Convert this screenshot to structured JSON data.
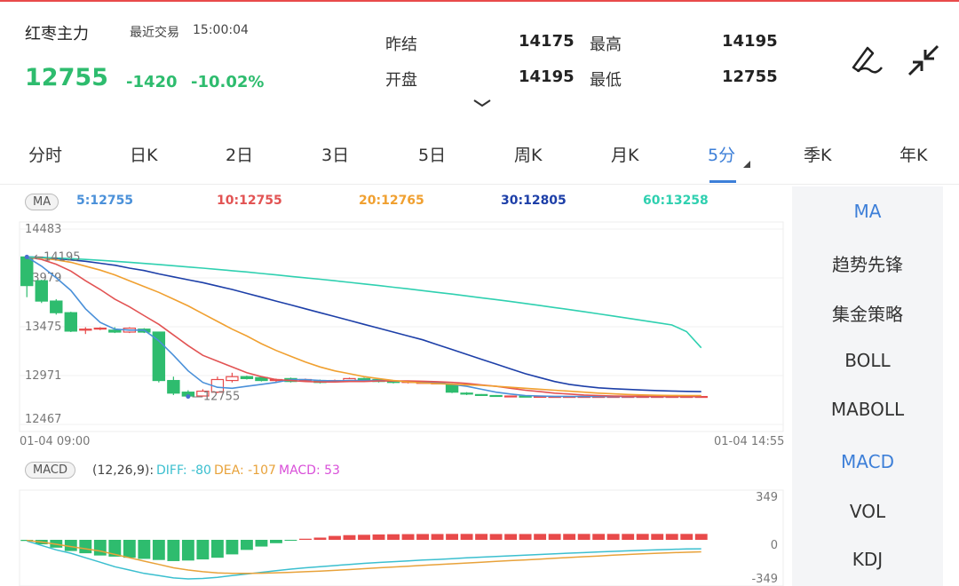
{
  "quote": {
    "name": "红枣主力",
    "trade_label": "最近交易",
    "trade_time": "15:00:04",
    "price": "12755",
    "change": "-1420",
    "change_pct": "-10.02%",
    "prev_settle_label": "昨结",
    "prev_settle": "14175",
    "open_label": "开盘",
    "open": "14195",
    "high_label": "最高",
    "high": "14195",
    "low_label": "最低",
    "low": "12755"
  },
  "tabs": [
    "分时",
    "日K",
    "2日",
    "3日",
    "5日",
    "周K",
    "月K",
    "5分",
    "季K",
    "年K"
  ],
  "active_tab": "5分",
  "ma_bar": {
    "pill": "MA",
    "ma5": "5:12755",
    "ma10": "10:12755",
    "ma20": "20:12765",
    "ma30": "30:12805",
    "ma60": "60:13258"
  },
  "main_indicators": [
    "MA",
    "趋势先锋",
    "集金策略",
    "BOLL",
    "MABOLL"
  ],
  "sub_indicators": [
    "MACD",
    "VOL",
    "KDJ"
  ],
  "macd_bar": {
    "pill": "MACD",
    "params": "(12,26,9):",
    "diff": "DIFF: -80",
    "dea": "DEA: -107",
    "macd": "MACD: 53"
  },
  "axis": {
    "price_ticks": [
      "14483",
      "13979",
      "13475",
      "12971",
      "12467"
    ],
    "max_marker": "14195",
    "min_marker": "12755",
    "time_start": "01-04 09:00",
    "time_end": "01-04 14:55",
    "macd_ticks": [
      "349",
      "0",
      "-349"
    ]
  },
  "colors": {
    "up": "#e84a4a",
    "down": "#2ebc6e",
    "ma5": "#4a90d9",
    "ma10": "#e25353",
    "ma20": "#f0a030",
    "ma30": "#1d3fa8",
    "ma60": "#2fd0b0",
    "diff": "#3bbfcf",
    "dea": "#e8a23a",
    "macd": "#d94fd9",
    "accent": "#3d7fd8"
  },
  "chart_data": [
    {
      "type": "candlestick",
      "x_range": [
        "01-04 09:00",
        "01-04 14:55"
      ],
      "ylim": [
        12467,
        14483
      ],
      "candles": [
        {
          "o": 14195,
          "c": 13900,
          "h": 14195,
          "l": 13780
        },
        {
          "o": 13950,
          "c": 13740,
          "h": 13960,
          "l": 13720
        },
        {
          "o": 13740,
          "c": 13620,
          "h": 13760,
          "l": 13600
        },
        {
          "o": 13620,
          "c": 13430,
          "h": 13630,
          "l": 13420
        },
        {
          "o": 13440,
          "c": 13450,
          "h": 13470,
          "l": 13400
        },
        {
          "o": 13460,
          "c": 13460,
          "h": 13470,
          "l": 13440
        },
        {
          "o": 13440,
          "c": 13420,
          "h": 13470,
          "l": 13410
        },
        {
          "o": 13420,
          "c": 13460,
          "h": 13470,
          "l": 13410
        },
        {
          "o": 13450,
          "c": 13420,
          "h": 13460,
          "l": 13410
        },
        {
          "o": 13420,
          "c": 12920,
          "h": 13420,
          "l": 12900
        },
        {
          "o": 12920,
          "c": 12790,
          "h": 12960,
          "l": 12770
        },
        {
          "o": 12800,
          "c": 12760,
          "h": 12820,
          "l": 12755
        },
        {
          "o": 12760,
          "c": 12810,
          "h": 12830,
          "l": 12755
        },
        {
          "o": 12800,
          "c": 12930,
          "h": 12960,
          "l": 12790
        },
        {
          "o": 12920,
          "c": 12960,
          "h": 13000,
          "l": 12900
        },
        {
          "o": 12960,
          "c": 12940,
          "h": 12970,
          "l": 12930
        },
        {
          "o": 12950,
          "c": 12920,
          "h": 12960,
          "l": 12910
        },
        {
          "o": 12920,
          "c": 12930,
          "h": 12940,
          "l": 12900
        },
        {
          "o": 12940,
          "c": 12910,
          "h": 12950,
          "l": 12900
        },
        {
          "o": 12920,
          "c": 12930,
          "h": 12940,
          "l": 12910
        },
        {
          "o": 12920,
          "c": 12900,
          "h": 12930,
          "l": 12890
        },
        {
          "o": 12910,
          "c": 12920,
          "h": 12930,
          "l": 12900
        },
        {
          "o": 12920,
          "c": 12940,
          "h": 12950,
          "l": 12910
        },
        {
          "o": 12940,
          "c": 12930,
          "h": 12950,
          "l": 12920
        },
        {
          "o": 12930,
          "c": 12910,
          "h": 12940,
          "l": 12900
        },
        {
          "o": 12910,
          "c": 12900,
          "h": 12920,
          "l": 12890
        },
        {
          "o": 12900,
          "c": 12910,
          "h": 12920,
          "l": 12890
        },
        {
          "o": 12900,
          "c": 12900,
          "h": 12910,
          "l": 12890
        },
        {
          "o": 12895,
          "c": 12895,
          "h": 12905,
          "l": 12885
        },
        {
          "o": 12880,
          "c": 12800,
          "h": 12890,
          "l": 12790
        },
        {
          "o": 12790,
          "c": 12780,
          "h": 12800,
          "l": 12770
        },
        {
          "o": 12775,
          "c": 12770,
          "h": 12780,
          "l": 12765
        },
        {
          "o": 12765,
          "c": 12760,
          "h": 12770,
          "l": 12755
        },
        {
          "o": 12760,
          "c": 12760,
          "h": 12765,
          "l": 12755
        },
        {
          "o": 12758,
          "c": 12757,
          "h": 12760,
          "l": 12755
        },
        {
          "o": 12756,
          "c": 12756,
          "h": 12758,
          "l": 12755
        },
        {
          "o": 12755,
          "c": 12755,
          "h": 12756,
          "l": 12755
        },
        {
          "o": 12755,
          "c": 12755,
          "h": 12755,
          "l": 12755
        },
        {
          "o": 12755,
          "c": 12755,
          "h": 12755,
          "l": 12755
        },
        {
          "o": 12755,
          "c": 12755,
          "h": 12755,
          "l": 12755
        },
        {
          "o": 12755,
          "c": 12755,
          "h": 12755,
          "l": 12755
        },
        {
          "o": 12755,
          "c": 12755,
          "h": 12755,
          "l": 12755
        },
        {
          "o": 12755,
          "c": 12755,
          "h": 12755,
          "l": 12755
        },
        {
          "o": 12755,
          "c": 12755,
          "h": 12755,
          "l": 12755
        },
        {
          "o": 12755,
          "c": 12755,
          "h": 12755,
          "l": 12755
        },
        {
          "o": 12755,
          "c": 12755,
          "h": 12755,
          "l": 12755
        },
        {
          "o": 12755,
          "c": 12755,
          "h": 12755,
          "l": 12755
        }
      ],
      "ma_lines": [
        {
          "name": "MA5",
          "values": [
            14195,
            14100,
            13980,
            13850,
            13660,
            13520,
            13450,
            13440,
            13440,
            13330,
            13180,
            13020,
            12900,
            12850,
            12840,
            12860,
            12880,
            12900,
            12930,
            12930,
            12920,
            12915,
            12920,
            12920,
            12920,
            12915,
            12910,
            12905,
            12900,
            12880,
            12860,
            12830,
            12800,
            12780,
            12765,
            12760,
            12757,
            12756,
            12755,
            12755,
            12755,
            12755,
            12755,
            12755,
            12755,
            12755,
            12755
          ]
        },
        {
          "name": "MA10",
          "values": [
            14195,
            14170,
            14120,
            14050,
            13950,
            13860,
            13760,
            13680,
            13590,
            13500,
            13390,
            13280,
            13180,
            13120,
            13060,
            13000,
            12960,
            12930,
            12920,
            12910,
            12905,
            12905,
            12910,
            12910,
            12915,
            12915,
            12915,
            12912,
            12908,
            12900,
            12890,
            12875,
            12860,
            12840,
            12820,
            12805,
            12790,
            12780,
            12770,
            12765,
            12760,
            12758,
            12757,
            12756,
            12755,
            12755,
            12755
          ]
        },
        {
          "name": "MA20",
          "values": [
            14195,
            14185,
            14165,
            14140,
            14100,
            14060,
            14010,
            13950,
            13890,
            13830,
            13760,
            13690,
            13610,
            13530,
            13450,
            13380,
            13300,
            13230,
            13170,
            13110,
            13060,
            13020,
            12990,
            12960,
            12940,
            12920,
            12905,
            12895,
            12888,
            12882,
            12876,
            12870,
            12860,
            12850,
            12840,
            12830,
            12820,
            12810,
            12800,
            12790,
            12782,
            12776,
            12771,
            12768,
            12766,
            12765,
            12765
          ]
        },
        {
          "name": "MA30",
          "values": [
            14195,
            14192,
            14180,
            14165,
            14150,
            14130,
            14110,
            14080,
            14055,
            14020,
            13990,
            13960,
            13930,
            13895,
            13860,
            13820,
            13780,
            13740,
            13700,
            13660,
            13620,
            13580,
            13540,
            13500,
            13460,
            13420,
            13380,
            13340,
            13290,
            13240,
            13190,
            13140,
            13090,
            13040,
            12990,
            12950,
            12910,
            12880,
            12860,
            12845,
            12835,
            12828,
            12822,
            12816,
            12812,
            12808,
            12805
          ]
        },
        {
          "name": "MA60",
          "values": [
            14195,
            14190,
            14185,
            14178,
            14170,
            14160,
            14150,
            14140,
            14128,
            14117,
            14105,
            14092,
            14080,
            14067,
            14053,
            14040,
            14025,
            14010,
            13995,
            13980,
            13965,
            13950,
            13933,
            13917,
            13900,
            13883,
            13866,
            13848,
            13830,
            13812,
            13793,
            13774,
            13755,
            13735,
            13715,
            13694,
            13673,
            13652,
            13630,
            13608,
            13586,
            13563,
            13540,
            13517,
            13493,
            13425,
            13258
          ]
        }
      ]
    },
    {
      "type": "bar",
      "title": "MACD",
      "ylim": [
        -349,
        349
      ],
      "macd": [
        -10,
        -40,
        -70,
        -100,
        -120,
        -140,
        -150,
        -160,
        -170,
        -180,
        -190,
        -185,
        -175,
        -160,
        -130,
        -90,
        -60,
        -30,
        -5,
        10,
        20,
        35,
        42,
        45,
        48,
        50,
        51,
        52,
        52,
        53,
        53,
        53,
        52,
        52,
        52,
        53,
        53,
        53,
        53,
        53,
        53,
        53,
        53,
        53,
        53,
        53,
        53
      ],
      "diff": [
        -10,
        -50,
        -90,
        -120,
        -160,
        -200,
        -240,
        -270,
        -300,
        -320,
        -340,
        -349,
        -345,
        -335,
        -320,
        -305,
        -290,
        -275,
        -262,
        -250,
        -240,
        -230,
        -220,
        -210,
        -202,
        -195,
        -188,
        -181,
        -175,
        -168,
        -161,
        -155,
        -149,
        -143,
        -137,
        -131,
        -125,
        -119,
        -114,
        -108,
        -103,
        -98,
        -93,
        -89,
        -85,
        -82,
        -80
      ],
      "dea": [
        -5,
        -20,
        -40,
        -60,
        -80,
        -100,
        -130,
        -160,
        -190,
        -220,
        -250,
        -270,
        -285,
        -295,
        -300,
        -300,
        -298,
        -294,
        -290,
        -285,
        -280,
        -273,
        -266,
        -258,
        -250,
        -243,
        -236,
        -228,
        -221,
        -214,
        -207,
        -200,
        -193,
        -186,
        -179,
        -172,
        -165,
        -158,
        -151,
        -144,
        -137,
        -131,
        -125,
        -120,
        -115,
        -111,
        -107
      ]
    }
  ]
}
